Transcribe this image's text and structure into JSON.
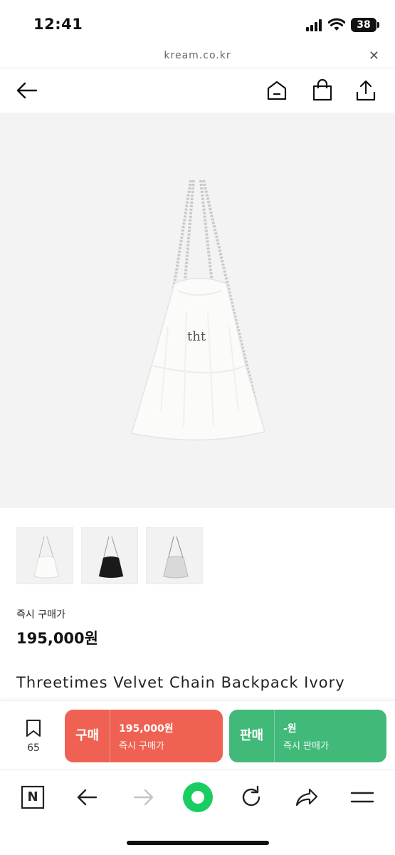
{
  "status": {
    "time": "12:41",
    "battery": "38"
  },
  "browser": {
    "url": "kream.co.kr",
    "close_glyph": "✕"
  },
  "nav": {
    "icons": [
      "back-arrow-icon",
      "home-icon",
      "shopping-bag-icon",
      "share-icon"
    ]
  },
  "product": {
    "thumbnails": [
      "ivory",
      "black",
      "grey"
    ],
    "price_label": "즉시 구매가",
    "price": "195,000원",
    "name": "Threetimes Velvet Chain Backpack Ivory"
  },
  "actions": {
    "wish_count": "65",
    "buy": {
      "label": "구매",
      "price": "195,000원",
      "sub": "즉시 구매가",
      "color": "#ef6253"
    },
    "sell": {
      "label": "판매",
      "price": "-원",
      "sub": "즉시 판매가",
      "color": "#41b979"
    }
  },
  "toolbar": {
    "n_label": "N",
    "icons": [
      "naver-n-icon",
      "back-icon",
      "forward-icon",
      "green-dot-icon",
      "reload-icon",
      "share-arrow-icon",
      "menu-icon"
    ]
  }
}
